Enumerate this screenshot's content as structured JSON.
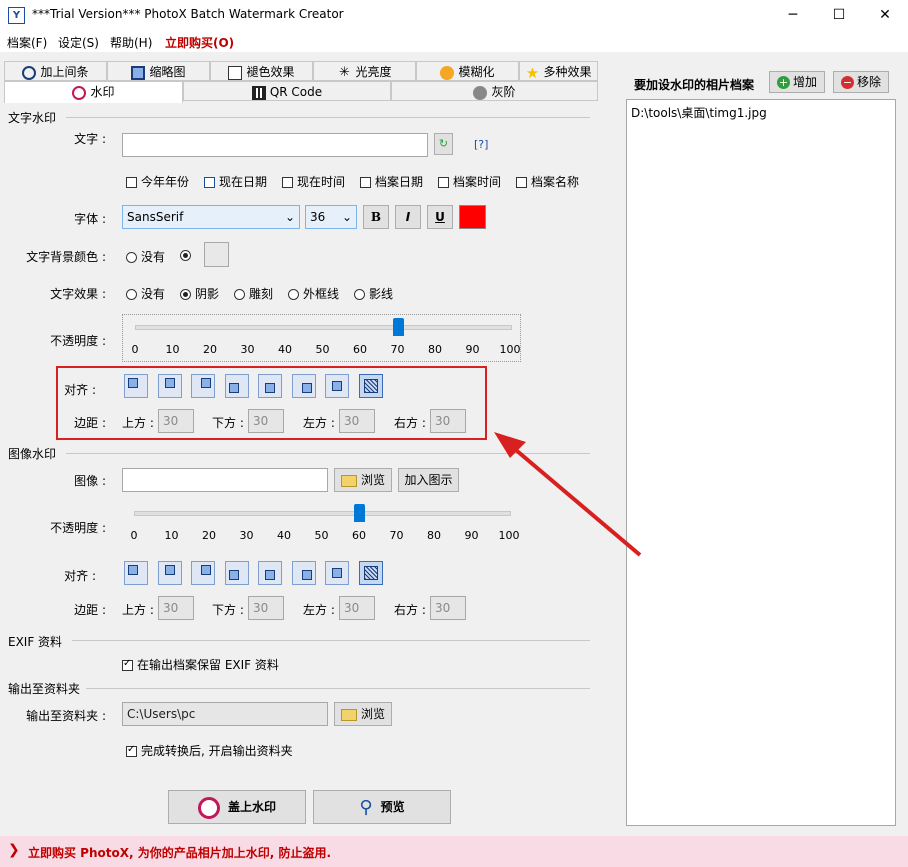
{
  "window": {
    "title": "***Trial Version*** PhotoX Batch Watermark Creator",
    "app_icon_letter": "Y",
    "minimize": "─",
    "maximize": "☐",
    "close": "✕"
  },
  "menu": {
    "file": "档案(F)",
    "settings": "设定(S)",
    "help": "帮助(H)",
    "buy": "立即购买(O)"
  },
  "tabs_row1": [
    "加上间条",
    "缩略图",
    "褪色效果",
    "光亮度",
    "模糊化",
    "多种效果"
  ],
  "tabs_row2": [
    "水印",
    "QR Code",
    "灰阶"
  ],
  "text_watermark": {
    "section": "文字水印",
    "text_label": "文字 :",
    "text_value": "",
    "help_link": "[?]",
    "checkboxes": [
      "今年年份",
      "现在日期",
      "现在时间",
      "档案日期",
      "档案时间",
      "档案名称"
    ],
    "font_label": "字体 :",
    "font_value": "SansSerif",
    "size_value": "36",
    "bold": "B",
    "italic": "I",
    "underline": "U",
    "font_color": "#ff0000",
    "bg_label": "文字背景颜色 :",
    "bg_none": "没有",
    "effect_label": "文字效果 :",
    "effects": [
      "没有",
      "阴影",
      "雕刻",
      "外框线",
      "影线"
    ],
    "opacity_label": "不透明度 :",
    "opacity": 70,
    "ticks": [
      "0",
      "10",
      "20",
      "30",
      "40",
      "50",
      "60",
      "70",
      "80",
      "90",
      "100"
    ],
    "align_label": "对齐 :",
    "margin_label": "边距 :",
    "margins": [
      {
        "label": "上方 :",
        "value": "30"
      },
      {
        "label": "下方 :",
        "value": "30"
      },
      {
        "label": "左方 :",
        "value": "30"
      },
      {
        "label": "右方 :",
        "value": "30"
      }
    ]
  },
  "image_watermark": {
    "section": "图像水印",
    "image_label": "图像 :",
    "image_value": "",
    "browse": "浏览",
    "add_sample": "加入图示",
    "opacity_label": "不透明度 :",
    "opacity": 60,
    "ticks": [
      "0",
      "10",
      "20",
      "30",
      "40",
      "50",
      "60",
      "70",
      "80",
      "90",
      "100"
    ],
    "align_label": "对齐 :",
    "margin_label": "边距 :",
    "margins": [
      {
        "label": "上方 :",
        "value": "30"
      },
      {
        "label": "下方 :",
        "value": "30"
      },
      {
        "label": "左方 :",
        "value": "30"
      },
      {
        "label": "右方 :",
        "value": "30"
      }
    ]
  },
  "exif": {
    "section": "EXIF 资料",
    "keep_label": "在输出档案保留 EXIF 资料"
  },
  "output": {
    "section": "输出至资料夹",
    "folder_label": "输出至资料夹 :",
    "folder_value": "C:\\Users\\pc",
    "browse": "浏览",
    "open_after": "完成转换后, 开启输出资料夹"
  },
  "actions": {
    "apply": "盖上水印",
    "preview": "预览"
  },
  "right": {
    "title": "要加设水印的相片档案",
    "add": "增加",
    "remove": "移除",
    "files": [
      "D:\\tools\\桌面\\timg1.jpg"
    ]
  },
  "status": {
    "text": "立即购买 PhotoX, 为你的产品相片加上水印, 防止盗用."
  }
}
